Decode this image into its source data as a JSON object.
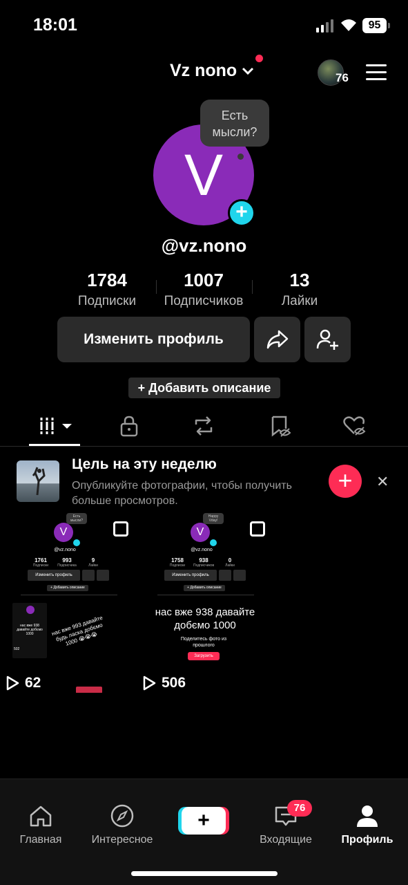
{
  "status_bar": {
    "time": "18:01",
    "battery": "95"
  },
  "header": {
    "title": "Vz nono",
    "notification_count": "76"
  },
  "profile": {
    "avatar_letter": "V",
    "bubble_text": "Есть мысли?",
    "username": "@vz.nono",
    "stats": [
      {
        "value": "1784",
        "label": "Подписки"
      },
      {
        "value": "1007",
        "label": "Подписчиков"
      },
      {
        "value": "13",
        "label": "Лайки"
      }
    ],
    "edit_button": "Изменить профиль",
    "add_description": "+ Добавить описание"
  },
  "tabs": [
    "videos",
    "private",
    "reposts",
    "favorites",
    "liked"
  ],
  "goal": {
    "title": "Цель на эту неделю",
    "text": "Опубликуйте фотографии, чтобы получить больше просмотров."
  },
  "videos": [
    {
      "views": "62",
      "mini": {
        "bubble": "Есть мысли?",
        "username": "@vz.nono",
        "stats": [
          {
            "value": "1761",
            "label": "Подписки"
          },
          {
            "value": "993",
            "label": "Подписчика"
          },
          {
            "value": "9",
            "label": "Лайки"
          }
        ],
        "edit": "Изменить профиль",
        "desc": "+ Добавить описание",
        "caption": "нас вже 993 давайте будь ласка добємо 1000 😭😭😭",
        "inner_caption": "нас вже 938 давайте добємо 1000",
        "inner_views": "502"
      }
    },
    {
      "views": "506",
      "mini": {
        "bubble": "Happy Vday!",
        "username": "@vz.nono",
        "stats": [
          {
            "value": "1758",
            "label": "Подписки"
          },
          {
            "value": "938",
            "label": "Подписчиков"
          },
          {
            "value": "0",
            "label": "Лайки"
          }
        ],
        "edit": "Изменить профиль",
        "desc": "+ Добавить описание",
        "caption": "нас вже 938 давайте добємо 1000",
        "share_text": "Поделитесь фото из прошлого",
        "upload": "Загрузить"
      }
    }
  ],
  "bottom_nav": [
    {
      "label": "Главная",
      "icon": "home-icon"
    },
    {
      "label": "Интересное",
      "icon": "compass-icon"
    },
    {
      "label": "",
      "icon": "plus-icon"
    },
    {
      "label": "Входящие",
      "icon": "inbox-icon",
      "badge": "76"
    },
    {
      "label": "Профиль",
      "icon": "profile-icon"
    }
  ],
  "colors": {
    "accent_red": "#fe2c55",
    "accent_cyan": "#20d5ec",
    "avatar_purple": "#8a2bb8"
  }
}
